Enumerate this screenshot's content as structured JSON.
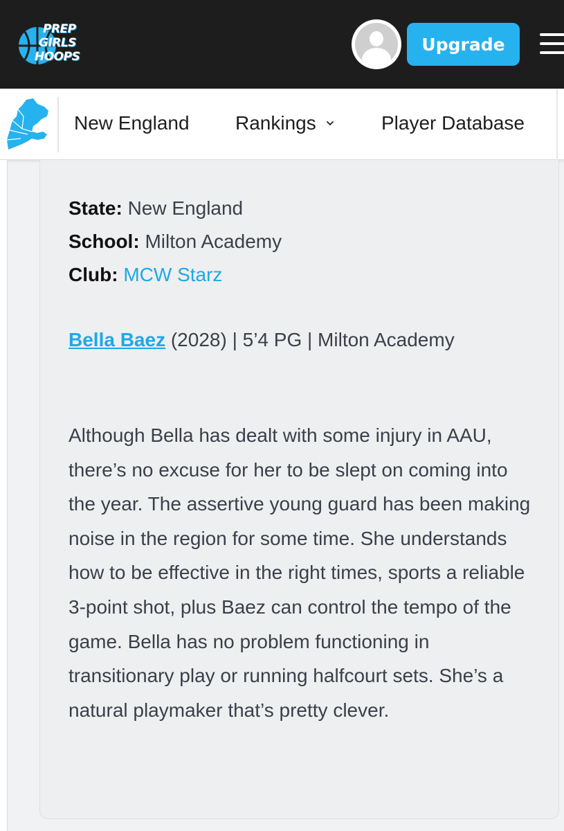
{
  "brand": {
    "logo_lines": [
      "PREP",
      "GIRLS",
      "HOOPS"
    ],
    "accent_color": "#26b2ef",
    "header_bg": "#1d1d1d"
  },
  "header": {
    "avatar_icon": "default-user-avatar-icon",
    "upgrade_label": "Upgrade",
    "menu_icon": "hamburger-menu-icon"
  },
  "nav": {
    "region_icon": "new-england-map-icon",
    "items": [
      {
        "label": "New England"
      },
      {
        "label": "Rankings",
        "icon": "chevron-down-icon"
      },
      {
        "label": "Player Database"
      }
    ]
  },
  "profile": {
    "state_label": "State:",
    "state_value": "New England",
    "school_label": "School:",
    "school_value": "Milton Academy",
    "club_label": "Club:",
    "club_value": "MCW Starz"
  },
  "player": {
    "name": "Bella Baez",
    "details": " (2028) | 5’4 PG | Milton Academy"
  },
  "description": "Although Bella has dealt with some injury in AAU, there’s no excuse for her to be slept on coming into the year. The assertive young guard has been making noise in the region for some time. She understands how to be effective in the right times, sports a reliable 3-point shot, plus Baez can control the tempo of the game. Bella has no problem functioning in transitionary play or running halfcourt sets. She’s a natural playmaker that’s pretty clever."
}
